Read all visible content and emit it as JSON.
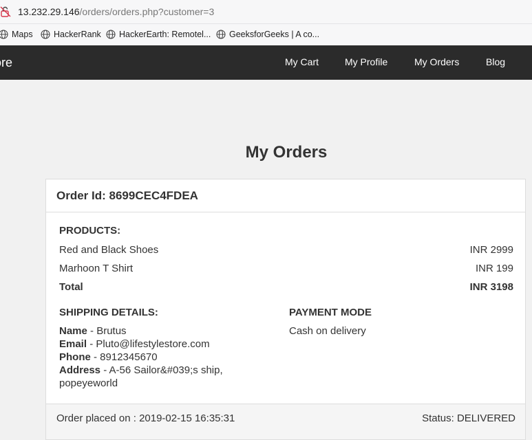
{
  "browser": {
    "url_host": "13.232.29.146",
    "url_path": "/orders/orders.php?customer=3",
    "bookmarks": [
      {
        "label": "Maps",
        "icon": "globe-icon"
      },
      {
        "label": "HackerRank",
        "icon": "globe-icon"
      },
      {
        "label": "HackerEarth: Remotel...",
        "icon": "globe-icon"
      },
      {
        "label": "GeeksforGeeks | A co...",
        "icon": "globe-icon"
      }
    ]
  },
  "navbar": {
    "brand": "tore",
    "links": [
      "My Cart",
      "My Profile",
      "My Orders",
      "Blog"
    ]
  },
  "page": {
    "title": "My Orders"
  },
  "order": {
    "id_label": "Order Id: 8699CEC4FDEA",
    "products_label": "PRODUCTS:",
    "items": [
      {
        "name": "Red and Black Shoes",
        "price": "INR 2999"
      },
      {
        "name": "Marhoon T Shirt",
        "price": "INR 199"
      }
    ],
    "total_label": "Total",
    "total_value": "INR 3198",
    "shipping_label": "SHIPPING DETAILS:",
    "shipping": {
      "name_key": "Name",
      "name_val": " - Brutus",
      "email_key": "Email",
      "email_val": " - Pluto@lifestylestore.com",
      "phone_key": "Phone",
      "phone_val": " - 8912345670",
      "address_key": "Address",
      "address_val": " - A-56 Sailor&#039;s ship, popeyeworld"
    },
    "payment_label": "PAYMENT MODE",
    "payment_value": "Cash on delivery",
    "placed_on": "Order placed on : 2019-02-15 16:35:31",
    "status": "Status: DELIVERED"
  },
  "colors": {
    "navbar_bg": "#2b2b2b",
    "page_bg": "#f1f1f1",
    "lock_icon": "#d6364a"
  }
}
